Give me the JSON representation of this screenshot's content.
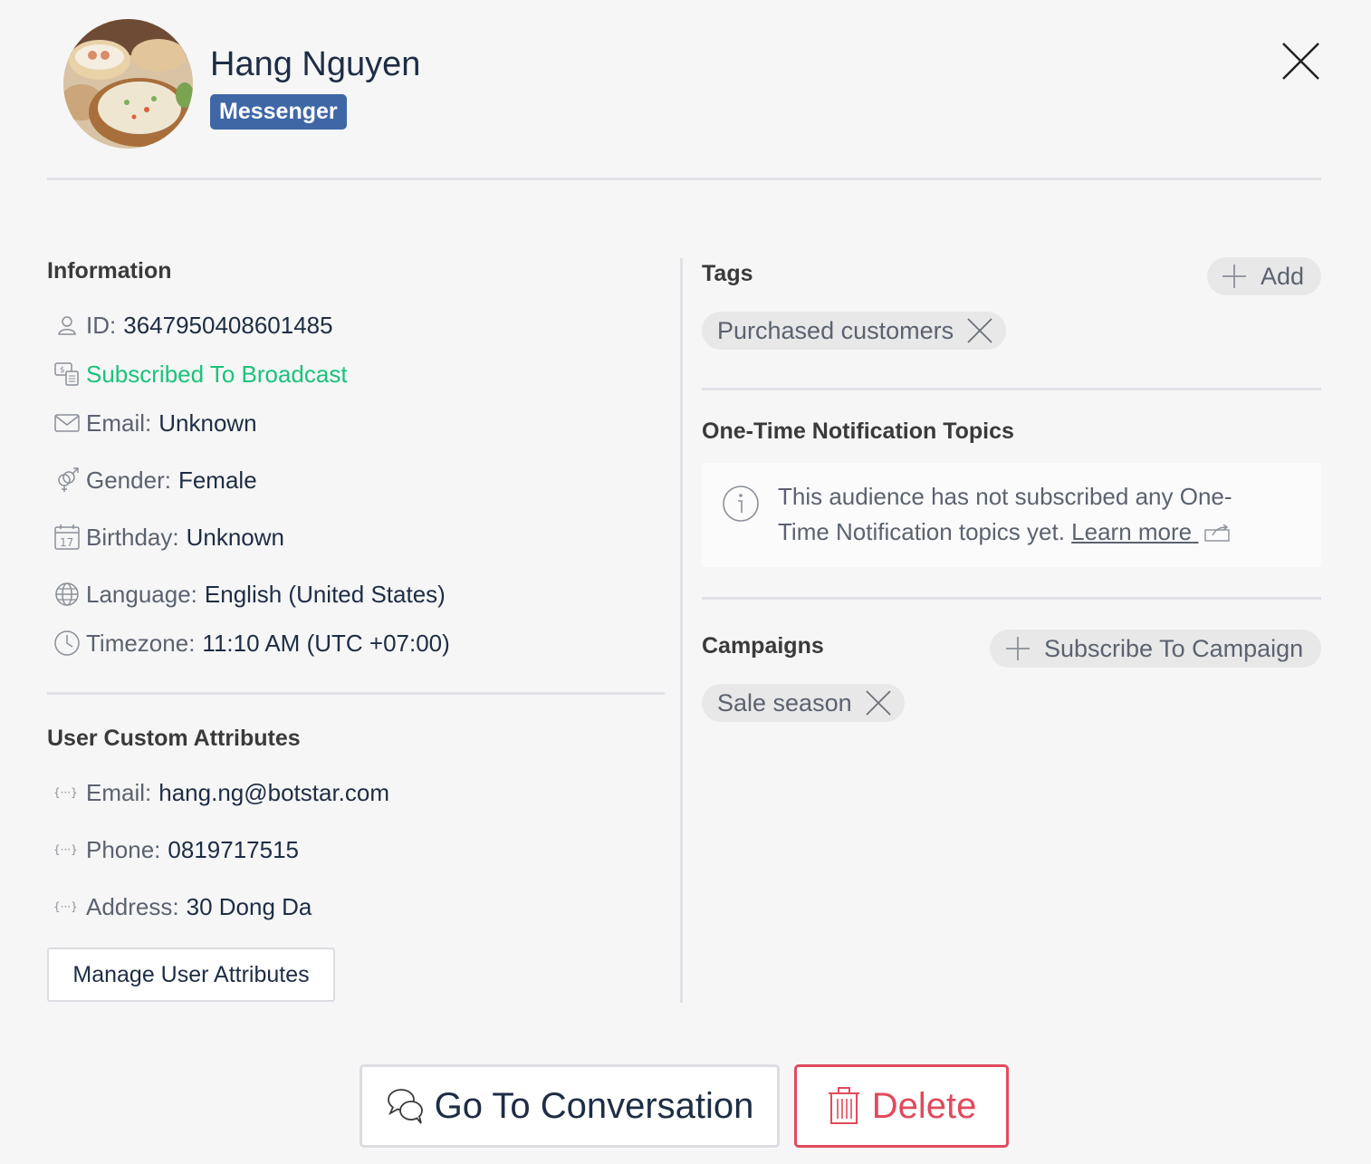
{
  "header": {
    "name": "Hang Nguyen",
    "channel": "Messenger"
  },
  "information": {
    "title": "Information",
    "id_label": "ID:",
    "id_value": "3647950408601485",
    "subscription_status": "Subscribed To Broadcast",
    "email_label": "Email:",
    "email_value": "Unknown",
    "gender_label": "Gender:",
    "gender_value": "Female",
    "birthday_label": "Birthday:",
    "birthday_value": "Unknown",
    "birthday_icon_day": "17",
    "language_label": "Language:",
    "language_value": "English (United States)",
    "timezone_label": "Timezone:",
    "timezone_value": "11:10 AM (UTC +07:00)"
  },
  "custom_attributes": {
    "title": "User Custom Attributes",
    "items": [
      {
        "label": "Email:",
        "value": "hang.ng@botstar.com"
      },
      {
        "label": "Phone:",
        "value": "0819717515"
      },
      {
        "label": "Address:",
        "value": "30 Dong Da"
      }
    ],
    "manage_button": "Manage User Attributes"
  },
  "tags": {
    "title": "Tags",
    "add_label": "Add",
    "items": [
      "Purchased customers"
    ]
  },
  "otn": {
    "title": "One-Time Notification Topics",
    "message_line1": "This audience has not subscribed any One-",
    "message_line2": "Time Notification topics yet.",
    "learn_more": "Learn more"
  },
  "campaigns": {
    "title": "Campaigns",
    "subscribe_label": "Subscribe To Campaign",
    "items": [
      "Sale season"
    ]
  },
  "footer": {
    "go_to_conversation": "Go To Conversation",
    "delete": "Delete"
  },
  "colors": {
    "badge": "#3f67a6",
    "subscribed_green": "#19c37a",
    "delete_red": "#e14a5c",
    "text_dark": "#1e2d45",
    "text_muted": "#5b6270"
  }
}
